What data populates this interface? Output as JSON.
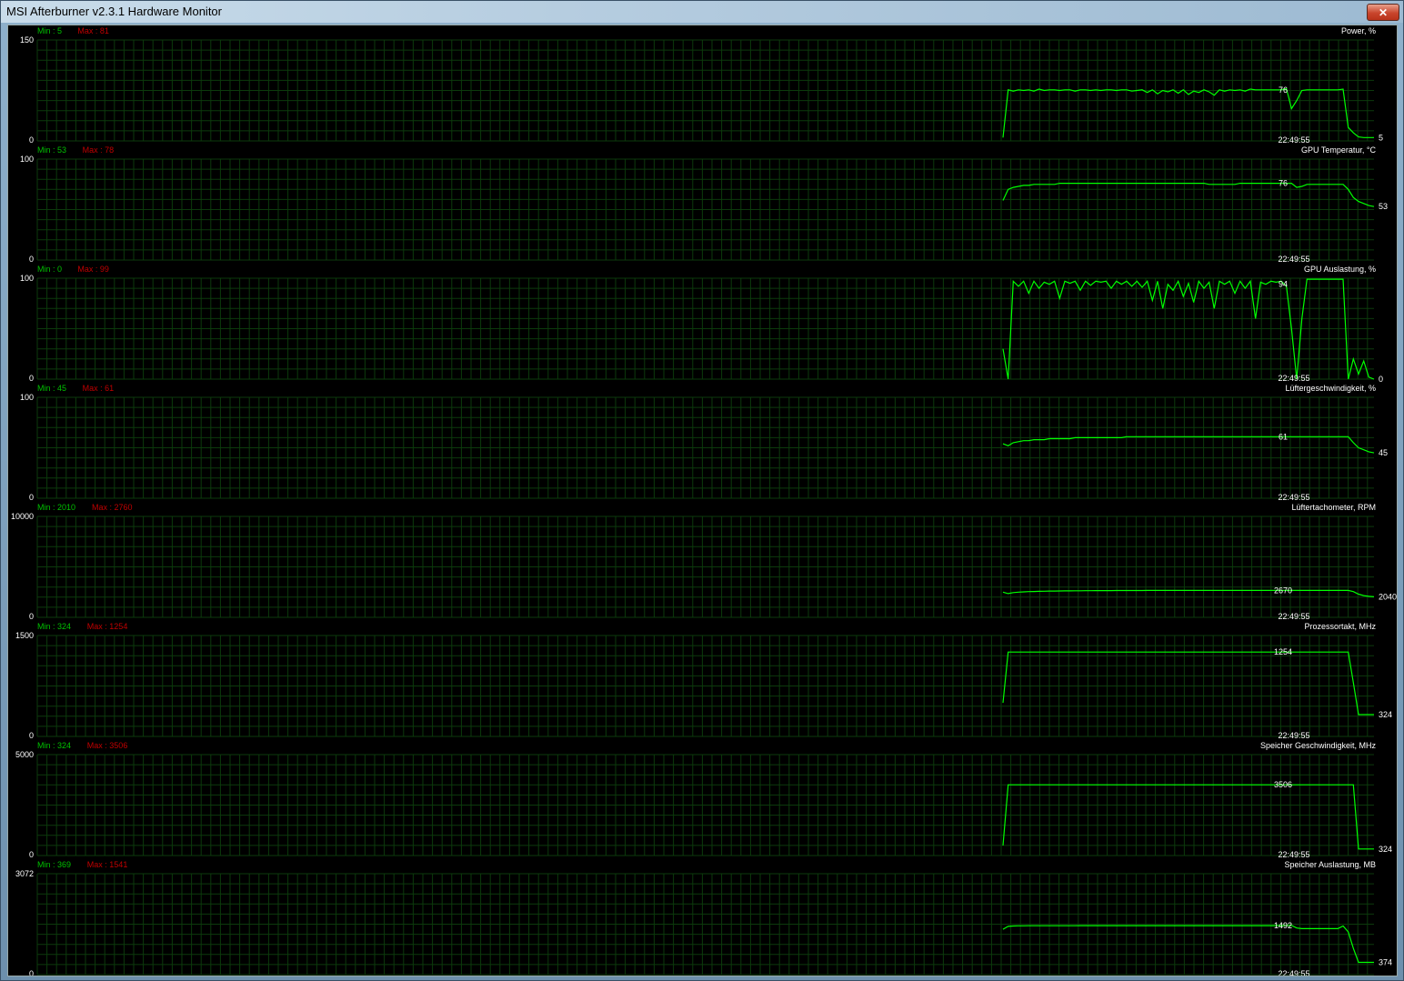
{
  "window": {
    "title": "MSI Afterburner v2.3.1 Hardware Monitor",
    "close_glyph": "✕"
  },
  "colors": {
    "background": "#000000",
    "grid": "#0c3a0c",
    "trace": "#00ff00",
    "min_label": "#00c000",
    "max_label": "#c00000",
    "text": "#ffffff"
  },
  "graphs": [
    {
      "name": "Power, %",
      "ymax_label": "150",
      "ymin_label": "0",
      "ymax": 150,
      "min_text": "Min : 5",
      "max_text": "Max : 81",
      "current": "76",
      "final": "5",
      "time": "22:49:55",
      "chart_data": {
        "type": "line",
        "ylim": [
          0,
          150
        ],
        "y": [
          5,
          76,
          74,
          76,
          75,
          76,
          74,
          77,
          75,
          76,
          76,
          75,
          76,
          76,
          74,
          76,
          76,
          75,
          76,
          75,
          76,
          76,
          75,
          76,
          76,
          74,
          75,
          76,
          72,
          76,
          70,
          75,
          73,
          76,
          71,
          76,
          69,
          74,
          72,
          76,
          73,
          68,
          76,
          74,
          76,
          75,
          76,
          74,
          77,
          76,
          76,
          76,
          76,
          76,
          76,
          78,
          48,
          60,
          75,
          76,
          76,
          76,
          76,
          76,
          76,
          76,
          77,
          20,
          12,
          6,
          5,
          5,
          5
        ]
      }
    },
    {
      "name": "GPU Temperatur, °C",
      "ymax_label": "100",
      "ymin_label": "0",
      "ymax": 100,
      "min_text": "Min : 53",
      "max_text": "Max : 78",
      "current": "76",
      "final": "53",
      "time": "22:49:55",
      "chart_data": {
        "type": "line",
        "ylim": [
          0,
          100
        ],
        "y": [
          59,
          70,
          72,
          73,
          74,
          74,
          75,
          75,
          75,
          75,
          75,
          76,
          76,
          76,
          76,
          76,
          76,
          76,
          76,
          76,
          76,
          76,
          76,
          76,
          76,
          76,
          76,
          76,
          76,
          76,
          76,
          76,
          76,
          76,
          76,
          76,
          76,
          76,
          76,
          76,
          75,
          75,
          75,
          75,
          75,
          75,
          76,
          76,
          76,
          76,
          76,
          76,
          76,
          76,
          76,
          76,
          76,
          72,
          73,
          75,
          75,
          75,
          75,
          75,
          75,
          75,
          75,
          70,
          62,
          58,
          56,
          54,
          53
        ]
      }
    },
    {
      "name": "GPU Auslastung, %",
      "ymax_label": "100",
      "ymin_label": "0",
      "ymax": 100,
      "min_text": "Min : 0",
      "max_text": "Max : 99",
      "current": "94",
      "final": "0",
      "time": "22:49:55",
      "chart_data": {
        "type": "line",
        "ylim": [
          0,
          100
        ],
        "y": [
          30,
          0,
          97,
          92,
          97,
          85,
          97,
          90,
          96,
          94,
          97,
          80,
          97,
          95,
          97,
          88,
          97,
          93,
          97,
          96,
          97,
          90,
          97,
          94,
          97,
          92,
          97,
          91,
          97,
          78,
          97,
          70,
          94,
          88,
          97,
          82,
          95,
          76,
          97,
          90,
          96,
          70,
          97,
          94,
          97,
          85,
          97,
          90,
          97,
          60,
          96,
          94,
          97,
          96,
          97,
          92,
          50,
          0,
          60,
          99,
          99,
          99,
          99,
          99,
          99,
          99,
          99,
          0,
          20,
          5,
          18,
          2,
          0
        ]
      }
    },
    {
      "name": "Lüftergeschwindigkeit, %",
      "ymax_label": "100",
      "ymin_label": "0",
      "ymax": 100,
      "min_text": "Min : 45",
      "max_text": "Max : 61",
      "current": "61",
      "final": "45",
      "time": "22:49:55",
      "chart_data": {
        "type": "line",
        "ylim": [
          0,
          100
        ],
        "y": [
          54,
          52,
          55,
          56,
          57,
          57,
          58,
          58,
          58,
          59,
          59,
          59,
          59,
          59,
          60,
          60,
          60,
          60,
          60,
          60,
          60,
          60,
          60,
          60,
          61,
          61,
          61,
          61,
          61,
          61,
          61,
          61,
          61,
          61,
          61,
          61,
          61,
          61,
          61,
          61,
          61,
          61,
          61,
          61,
          61,
          61,
          61,
          61,
          61,
          61,
          61,
          61,
          61,
          61,
          61,
          61,
          61,
          61,
          61,
          61,
          61,
          61,
          61,
          61,
          61,
          61,
          61,
          61,
          55,
          50,
          48,
          46,
          45
        ]
      }
    },
    {
      "name": "Lüftertachometer, RPM",
      "ymax_label": "10000",
      "ymin_label": "0",
      "ymax": 10000,
      "min_text": "Min : 2010",
      "max_text": "Max : 2760",
      "current": "2670",
      "final": "2040",
      "time": "22:49:55",
      "chart_data": {
        "type": "line",
        "ylim": [
          0,
          10000
        ],
        "y": [
          2500,
          2350,
          2450,
          2500,
          2520,
          2550,
          2560,
          2580,
          2590,
          2600,
          2600,
          2610,
          2620,
          2620,
          2630,
          2630,
          2640,
          2640,
          2650,
          2650,
          2650,
          2650,
          2660,
          2660,
          2660,
          2660,
          2660,
          2660,
          2670,
          2670,
          2670,
          2670,
          2670,
          2670,
          2670,
          2670,
          2670,
          2670,
          2670,
          2670,
          2670,
          2670,
          2670,
          2670,
          2670,
          2670,
          2670,
          2670,
          2670,
          2670,
          2670,
          2670,
          2670,
          2670,
          2670,
          2670,
          2670,
          2670,
          2670,
          2670,
          2670,
          2670,
          2670,
          2670,
          2670,
          2670,
          2670,
          2670,
          2550,
          2300,
          2150,
          2080,
          2040
        ]
      }
    },
    {
      "name": "Prozessortakt, MHz",
      "ymax_label": "1500",
      "ymin_label": "0",
      "ymax": 1500,
      "min_text": "Min : 324",
      "max_text": "Max : 1254",
      "current": "1254",
      "final": "324",
      "time": "22:49:55",
      "chart_data": {
        "type": "line",
        "ylim": [
          0,
          1500
        ],
        "y": [
          500,
          1254,
          1254,
          1254,
          1254,
          1254,
          1254,
          1254,
          1254,
          1254,
          1254,
          1254,
          1254,
          1254,
          1254,
          1254,
          1254,
          1254,
          1254,
          1254,
          1254,
          1254,
          1254,
          1254,
          1254,
          1254,
          1254,
          1254,
          1254,
          1254,
          1254,
          1254,
          1254,
          1254,
          1254,
          1254,
          1254,
          1254,
          1254,
          1254,
          1254,
          1254,
          1254,
          1254,
          1254,
          1254,
          1254,
          1254,
          1254,
          1254,
          1254,
          1254,
          1254,
          1254,
          1254,
          1254,
          1254,
          1254,
          1254,
          1254,
          1254,
          1254,
          1254,
          1254,
          1254,
          1254,
          1254,
          1254,
          800,
          324,
          324,
          324,
          324
        ]
      }
    },
    {
      "name": "Speicher Geschwindigkeit, MHz",
      "ymax_label": "5000",
      "ymin_label": "0",
      "ymax": 5000,
      "min_text": "Min : 324",
      "max_text": "Max : 3506",
      "current": "3506",
      "final": "324",
      "time": "22:49:55",
      "chart_data": {
        "type": "line",
        "ylim": [
          0,
          5000
        ],
        "y": [
          500,
          3506,
          3506,
          3506,
          3506,
          3506,
          3506,
          3506,
          3506,
          3506,
          3506,
          3506,
          3506,
          3506,
          3506,
          3506,
          3506,
          3506,
          3506,
          3506,
          3506,
          3506,
          3506,
          3506,
          3506,
          3506,
          3506,
          3506,
          3506,
          3506,
          3506,
          3506,
          3506,
          3506,
          3506,
          3506,
          3506,
          3506,
          3506,
          3506,
          3506,
          3506,
          3506,
          3506,
          3506,
          3506,
          3506,
          3506,
          3506,
          3506,
          3506,
          3506,
          3506,
          3506,
          3506,
          3506,
          3506,
          3506,
          3506,
          3506,
          3506,
          3506,
          3506,
          3506,
          3506,
          3506,
          3506,
          3506,
          3506,
          324,
          324,
          324,
          324
        ]
      }
    },
    {
      "name": "Speicher Auslastung, MB",
      "ymax_label": "3072",
      "ymin_label": "0",
      "ymax": 3072,
      "min_text": "Min : 369",
      "max_text": "Max : 1541",
      "current": "1492",
      "final": "374",
      "time": "22:49:55",
      "chart_data": {
        "type": "line",
        "ylim": [
          0,
          3072
        ],
        "y": [
          1380,
          1470,
          1480,
          1485,
          1485,
          1488,
          1488,
          1490,
          1490,
          1490,
          1490,
          1490,
          1490,
          1490,
          1490,
          1492,
          1492,
          1492,
          1492,
          1492,
          1492,
          1492,
          1492,
          1492,
          1492,
          1492,
          1492,
          1492,
          1492,
          1492,
          1492,
          1492,
          1492,
          1492,
          1492,
          1492,
          1492,
          1492,
          1492,
          1492,
          1492,
          1492,
          1492,
          1492,
          1492,
          1492,
          1492,
          1492,
          1492,
          1492,
          1492,
          1492,
          1492,
          1492,
          1492,
          1492,
          1500,
          1420,
          1400,
          1400,
          1400,
          1400,
          1400,
          1400,
          1400,
          1400,
          1480,
          1300,
          800,
          374,
          374,
          374,
          374
        ]
      }
    }
  ]
}
